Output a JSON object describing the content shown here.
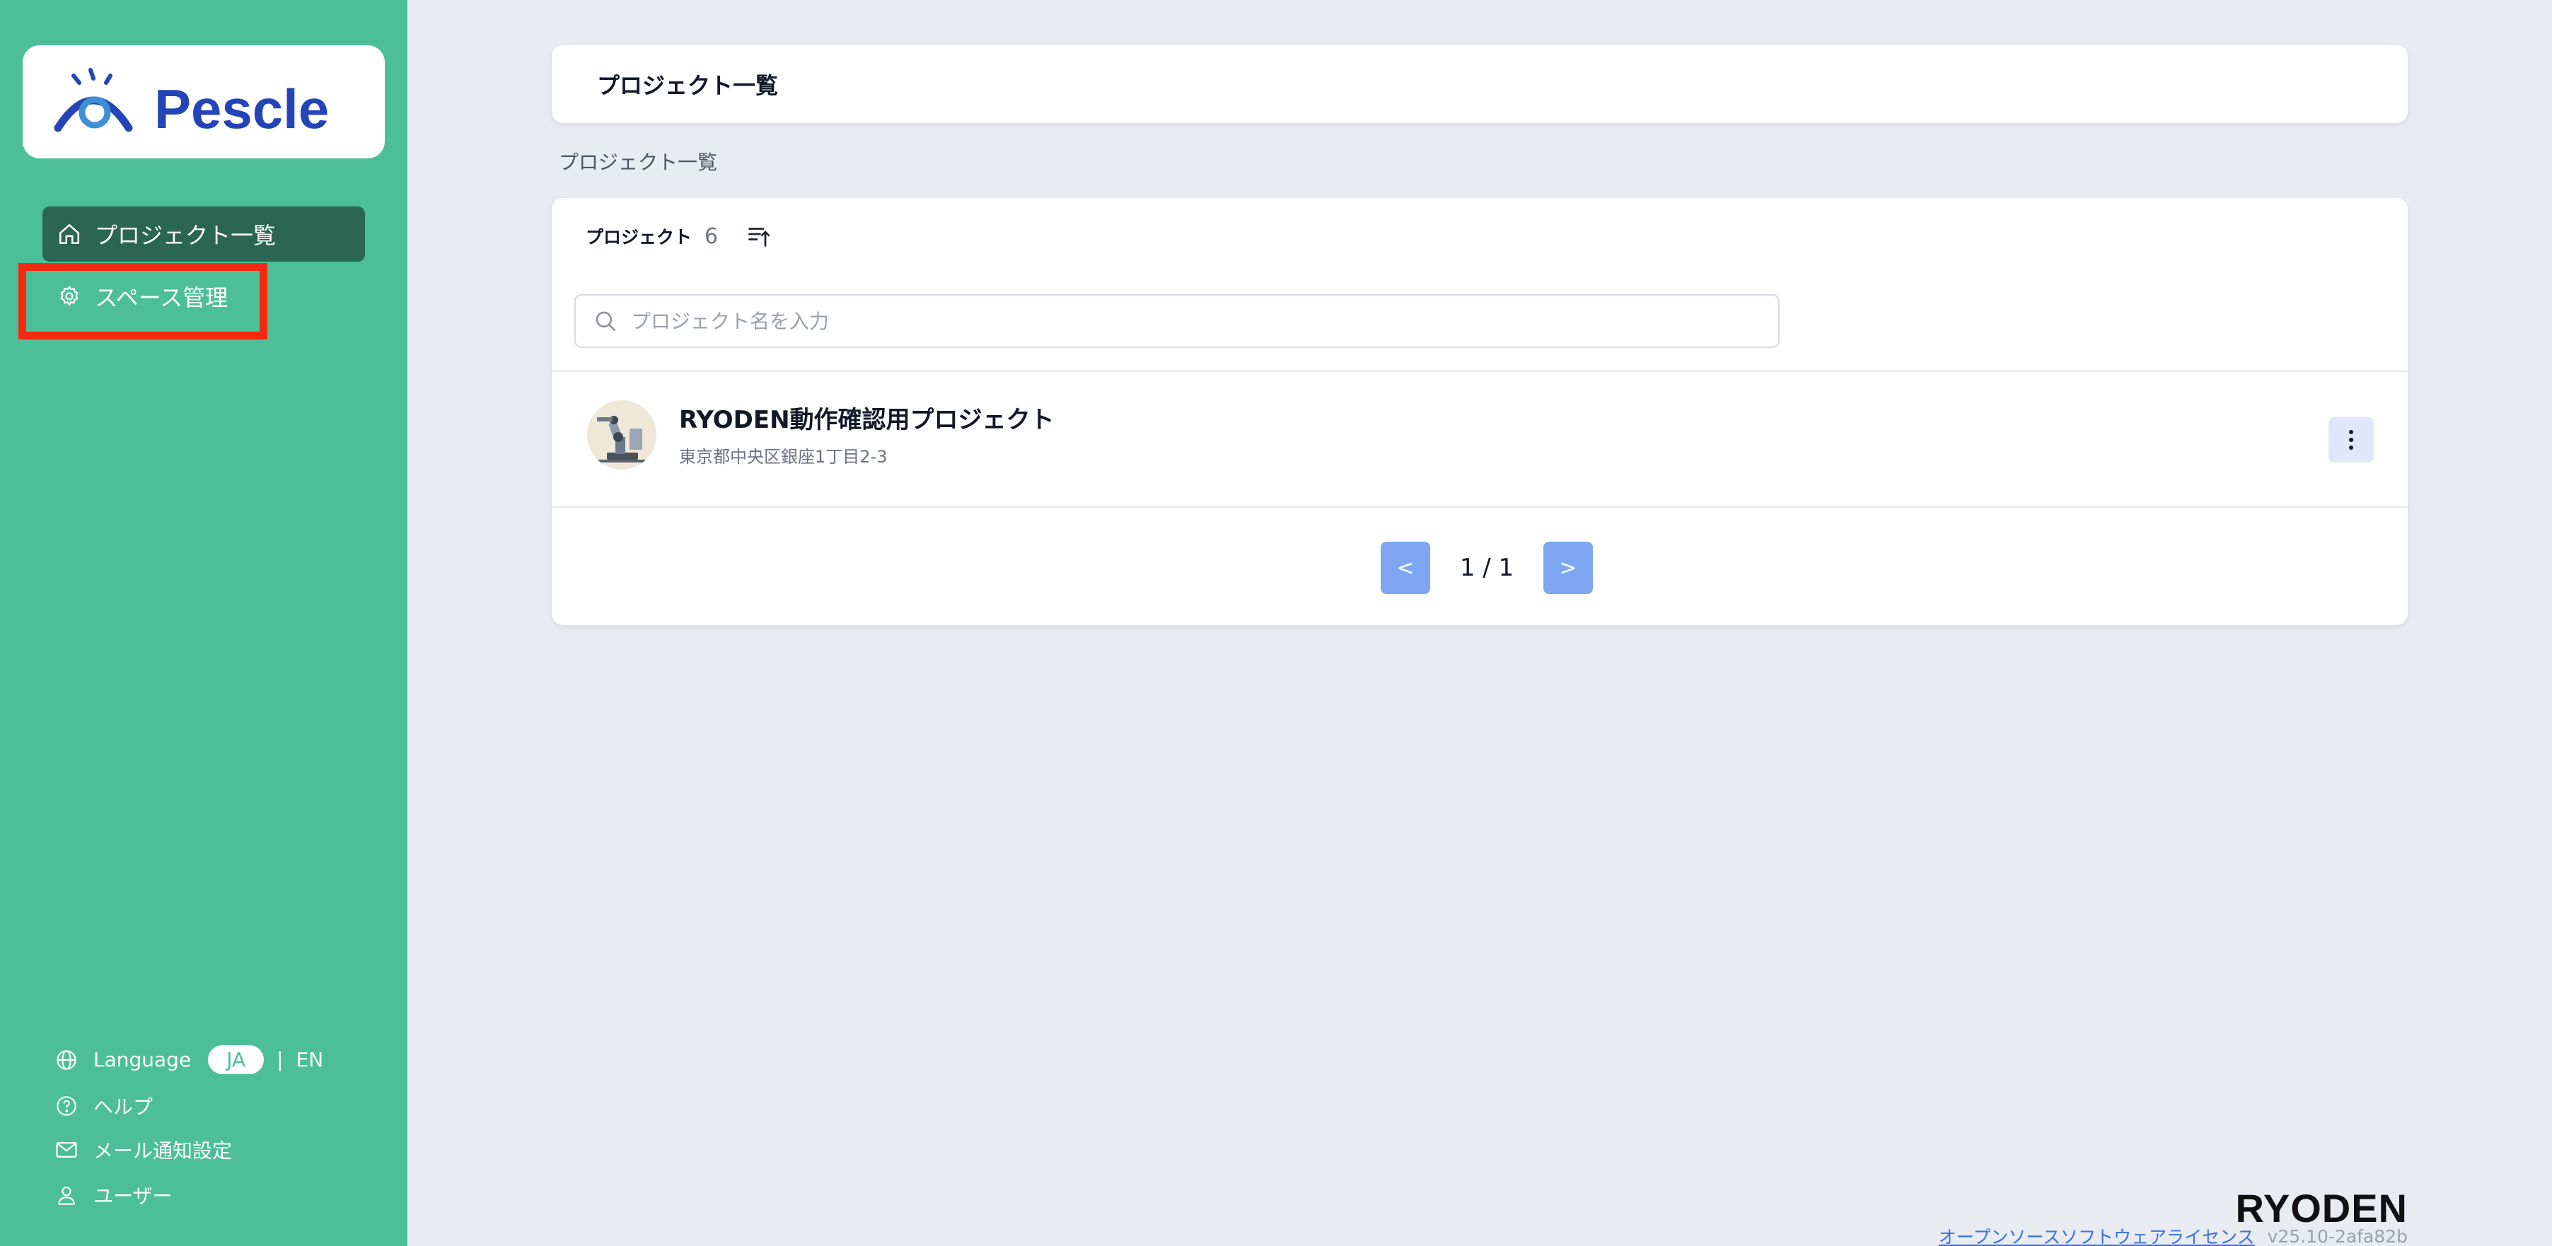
{
  "brand": {
    "logo_text": "Pescle",
    "company": "RYODEN"
  },
  "sidebar": {
    "nav": [
      {
        "label": "プロジェクト一覧",
        "icon": "home-icon",
        "active": true
      },
      {
        "label": "スペース管理",
        "icon": "gear-icon",
        "active": false
      }
    ],
    "language": {
      "label": "Language",
      "options": [
        "JA",
        "EN"
      ],
      "selected": "JA",
      "separator": "|"
    },
    "help_label": "ヘルプ",
    "mail_label": "メール通知設定",
    "user_label": "ユーザー"
  },
  "header": {
    "title": "プロジェクト一覧"
  },
  "breadcrumb": "プロジェクト一覧",
  "project_list": {
    "header_label": "プロジェクト",
    "count": "6",
    "search_placeholder": "プロジェクト名を入力",
    "projects": [
      {
        "name": "RYODEN動作確認用プロジェクト",
        "address": "東京都中央区銀座1丁目2-3"
      }
    ],
    "pagination": {
      "prev": "<",
      "next": ">",
      "text": "1 / 1"
    }
  },
  "footer": {
    "oss_link": "オープンソースソフトウェアライセンス",
    "version": "v25.10-2afa82b"
  },
  "colors": {
    "sidebar": "#4cbf98",
    "active_nav": "#2a6651",
    "highlight": "#f5290f",
    "pager_button": "#7ea6f2",
    "background": "#e8ebf0"
  }
}
